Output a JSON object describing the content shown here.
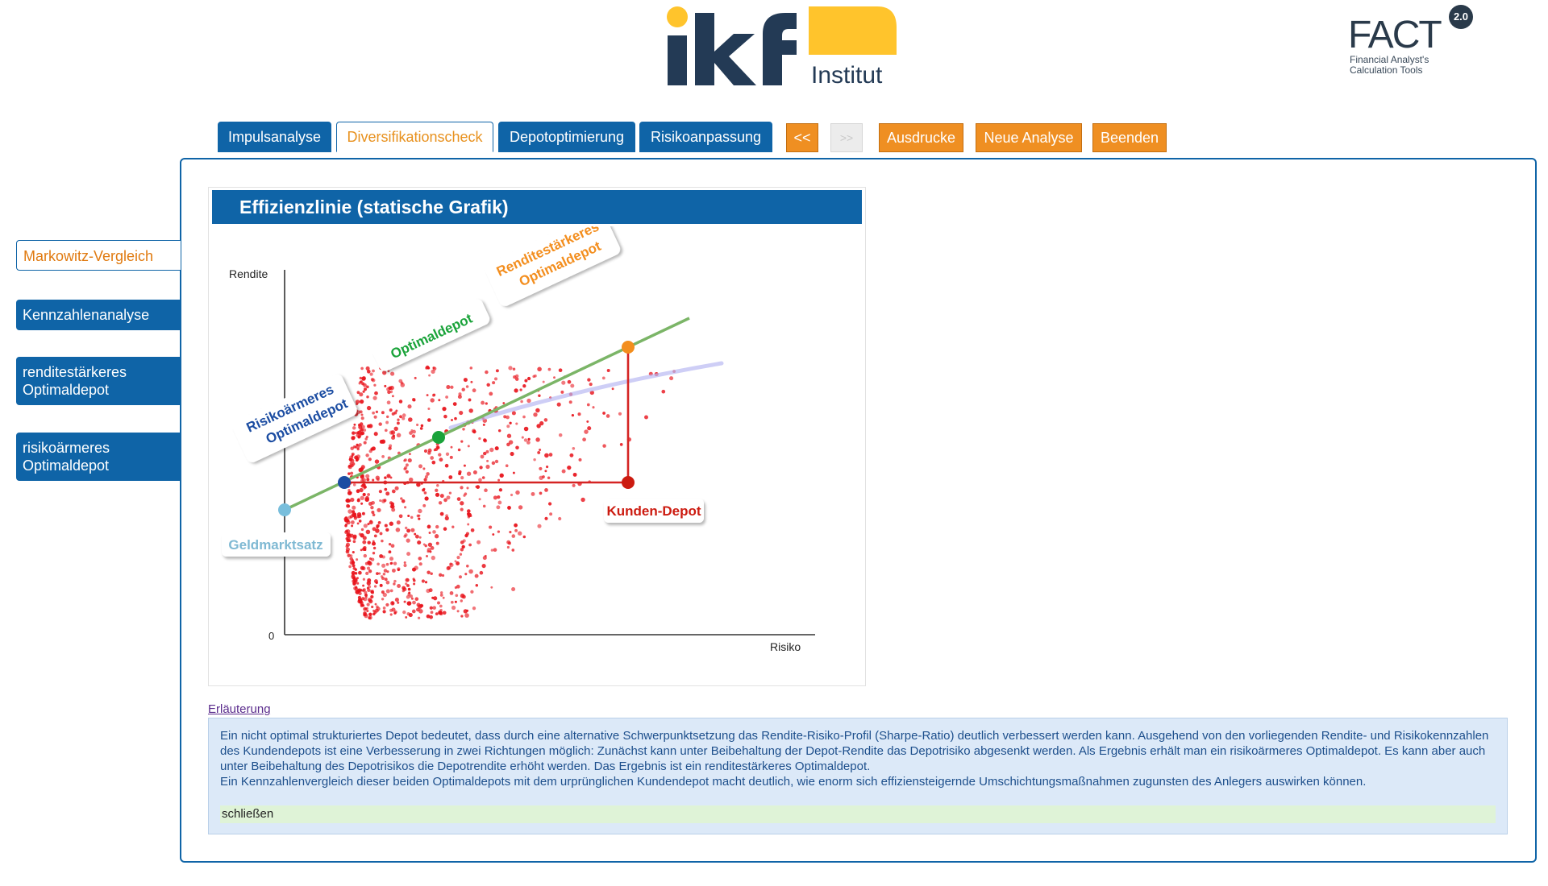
{
  "header": {
    "ikf_logo": {
      "text_big": "ikf",
      "text_small": "Institut",
      "colors": {
        "dark": "#233a55",
        "yellow": "#ffc42c"
      }
    },
    "fact_logo": {
      "word": "FACT",
      "badge": "2.0",
      "line1": "Financial Analyst's",
      "line2": "Calculation Tools"
    }
  },
  "nav": {
    "tabs": [
      {
        "label": "Impulsanalyse",
        "state": "default"
      },
      {
        "label": "Diversifikationscheck",
        "state": "active"
      },
      {
        "label": "Depotoptimierung",
        "state": "default"
      },
      {
        "label": "Risikoanpassung",
        "state": "default"
      }
    ],
    "prev_label": "<<",
    "next_label": ">>",
    "ausdrucke_label": "Ausdrucke",
    "neue_analyse_label": "Neue Analyse",
    "beenden_label": "Beenden"
  },
  "sidebar": {
    "items": [
      {
        "line1": "Markowitz-Vergleich",
        "line2": "",
        "state": "active"
      },
      {
        "line1": "Kennzahlenanalyse",
        "line2": "",
        "state": "default"
      },
      {
        "line1": "renditestärkeres",
        "line2": "Optimaldepot",
        "state": "default"
      },
      {
        "line1": "risikoärmeres",
        "line2": "Optimaldepot",
        "state": "default"
      }
    ]
  },
  "chart_card": {
    "title": "Effizienzlinie (statische Grafik)"
  },
  "chart_data": {
    "type": "scatter",
    "title": "Effizienzlinie (statische Grafik)",
    "xlabel": "Risiko",
    "ylabel": "Rendite",
    "origin_label": "0",
    "labels": {
      "geldmarktsatz": "Geldmarktsatz",
      "risikoarm_1": "Risikoärmeres",
      "risikoarm_2": "Optimaldepot",
      "optimal": "Optimaldepot",
      "rendite_1": "Renditestärkeres",
      "rendite_2": "Optimaldepot",
      "kunden": "Kunden-Depot"
    },
    "colors": {
      "points": "#e8121a",
      "capital_line": "#7bb567",
      "frontier": "#b9b9f2",
      "rect": "#d52423",
      "geldmarkt": "#78bedc",
      "risikoarm": "#1c4da2",
      "optimal": "#1aa33a",
      "rendite": "#f38e1e",
      "kunden": "#cc1b10"
    }
  },
  "explanation": {
    "link_label": "Erläuterung",
    "line1": "Ein nicht optimal strukturiertes Depot bedeutet, dass durch eine alternative Schwerpunktsetzung das Rendite-Risiko-Profil (Sharpe-Ratio) deutlich verbessert werden kann. Ausgehend von den vorliegenden Rendite- und Risikokennzahlen des Kundendepots ist eine Verbesserung in zwei Richtungen möglich: Zunächst kann unter Beibehaltung der Depot-Rendite das Depotrisiko abgesenkt werden. Als Ergebnis erhält man ein risikoärmeres Optimaldepot. Es kann aber auch unter Beibehaltung des Depotrisikos die Depotrendite erhöht werden. Das Ergebnis ist ein renditestärkeres Optimaldepot.",
    "line2": "Ein Kennzahlenvergleich dieser beiden Optimaldepots mit dem urprünglichen Kundendepot macht deutlich, wie enorm sich effiziensteigernde Umschichtungsmaßnahmen zugunsten des Anlegers auswirken können.",
    "close_label": "schließen"
  }
}
